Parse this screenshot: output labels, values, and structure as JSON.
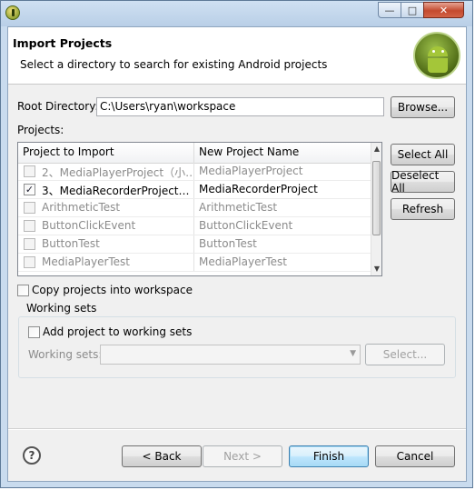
{
  "window": {
    "minimize": "—",
    "maximize": "□",
    "close": "✕"
  },
  "header": {
    "title": "Import Projects",
    "description": "Select a directory to search for existing Android projects"
  },
  "root_directory": {
    "label": "Root Directory:",
    "value": "C:\\Users\\ryan\\workspace",
    "browse_label": "Browse..."
  },
  "projects": {
    "label": "Projects:",
    "columns": [
      "Project to Import",
      "New Project Name"
    ],
    "rows": [
      {
        "checked": false,
        "enabled": false,
        "project": "2、MediaPlayerProject（小…",
        "name": "MediaPlayerProject"
      },
      {
        "checked": true,
        "enabled": true,
        "project": "3、MediaRecorderProject…",
        "name": "MediaRecorderProject"
      },
      {
        "checked": false,
        "enabled": false,
        "project": "ArithmeticTest",
        "name": "ArithmeticTest"
      },
      {
        "checked": false,
        "enabled": false,
        "project": "ButtonClickEvent",
        "name": "ButtonClickEvent"
      },
      {
        "checked": false,
        "enabled": false,
        "project": "ButtonTest",
        "name": "ButtonTest"
      },
      {
        "checked": false,
        "enabled": false,
        "project": "MediaPlayerTest",
        "name": "MediaPlayerTest"
      }
    ],
    "select_all": "Select All",
    "deselect_all": "Deselect All",
    "refresh": "Refresh"
  },
  "copy_projects": {
    "label": "Copy projects into workspace",
    "checked": false
  },
  "working_sets": {
    "group_title": "Working sets",
    "add_label": "Add project to working sets",
    "add_checked": false,
    "field_label": "Working sets:",
    "value": "",
    "select_label": "Select..."
  },
  "footer": {
    "help_icon": "?",
    "back": "< Back",
    "next": "Next >",
    "finish": "Finish",
    "cancel": "Cancel"
  }
}
